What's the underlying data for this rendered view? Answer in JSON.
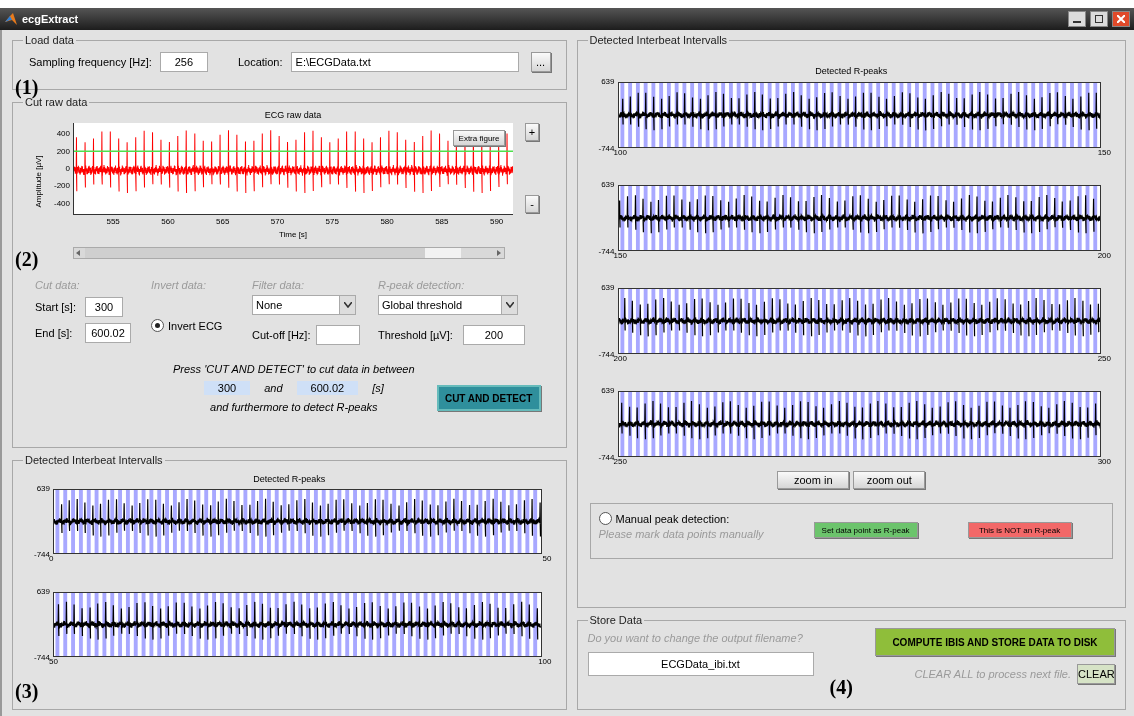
{
  "window": {
    "title": "ecgExtract"
  },
  "load_data": {
    "title": "Load data",
    "marker": "(1)",
    "sampling_label": "Sampling frequency [Hz]:",
    "sampling_value": "256",
    "location_label": "Location:",
    "location_value": "E:\\ECGData.txt",
    "browse_button": "..."
  },
  "cut_raw_data": {
    "title": "Cut raw data",
    "marker": "(2)",
    "plot": {
      "title": "ECG raw data",
      "ylabel": "Amplitude [µV]",
      "xlabel": "Time [s]",
      "yticks": [
        "400",
        "200",
        "0",
        "-200",
        "-400"
      ],
      "xticks": [
        "555",
        "560",
        "565",
        "570",
        "575",
        "580",
        "585",
        "590"
      ]
    },
    "extra_figure_button": "Extra figure",
    "plus_button": "+",
    "minus_button": "-",
    "cut_data": {
      "heading": "Cut data:",
      "start_label": "Start [s]:",
      "start_value": "300",
      "end_label": "End [s]:",
      "end_value": "600.02"
    },
    "invert_data": {
      "heading": "Invert data:",
      "option": "Invert ECG",
      "checked": true
    },
    "filter_data": {
      "heading": "Filter data:",
      "select": "None",
      "cutoff_label": "Cut-off [Hz]:"
    },
    "rpeak_detection": {
      "heading": "R-peak detection:",
      "select": "Global threshold",
      "threshold_label": "Threshold [µV]:",
      "threshold_value": "200"
    },
    "message": {
      "line_1": "Press 'CUT AND DETECT' to cut data in between",
      "from": "300",
      "and": "and",
      "to": "600.02",
      "unit": "[s]",
      "line_3": "and furthermore to detect R-peaks"
    },
    "cut_button": "CUT AND DETECT"
  },
  "left_intervals": {
    "title": "Detected Interbeat Intervalls",
    "marker": "(3)",
    "plot_title": "Detected R-peaks",
    "plots": [
      {
        "ymax": "639",
        "ymin": "-744",
        "xstart": "0",
        "xend": "50"
      },
      {
        "ymax": "639",
        "ymin": "-744",
        "xstart": "50",
        "xend": "100"
      }
    ]
  },
  "right_intervals": {
    "title": "Detected Interbeat Intervalls",
    "plot_title": "Detected R-peaks",
    "plots": [
      {
        "ymax": "639",
        "ymin": "-744",
        "xstart": "100",
        "xend": "150"
      },
      {
        "ymax": "639",
        "ymin": "-744",
        "xstart": "150",
        "xend": "200"
      },
      {
        "ymax": "639",
        "ymin": "-744",
        "xstart": "200",
        "xend": "250"
      },
      {
        "ymax": "639",
        "ymin": "-744",
        "xstart": "250",
        "xend": "300"
      }
    ],
    "zoom_in": "zoom in",
    "zoom_out": "zoom out",
    "manual": {
      "option": "Manual peak detection:",
      "checked": false,
      "hint": "Please mark data points manually",
      "set_button": "Set data point as R-peak",
      "not_button": "This is NOT an R-peak"
    }
  },
  "store_data": {
    "title": "Store Data",
    "marker": "(4)",
    "hint": "Do you want to change the output filename?",
    "filename": "ECGData_ibi.txt",
    "compute_button": "COMPUTE IBIS AND STORE DATA TO DISK",
    "clear_hint": "CLEAR ALL to process next file.",
    "clear_button": "CLEAR"
  }
}
